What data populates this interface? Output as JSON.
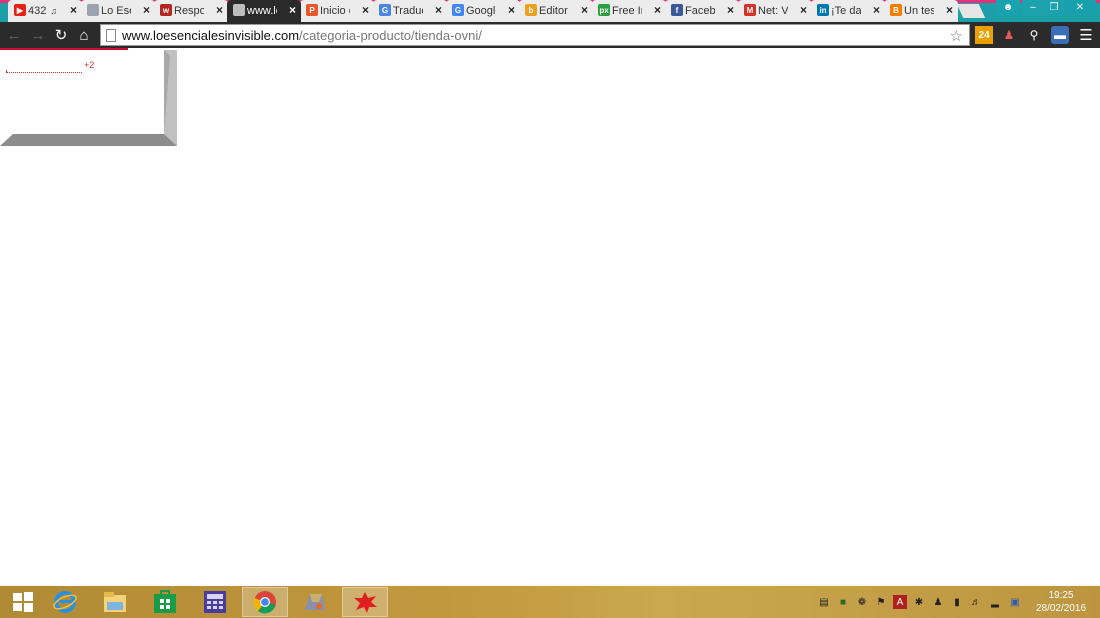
{
  "browser": {
    "tabs": [
      {
        "title": "432",
        "favicon": "youtube-icon",
        "color": "#e62117",
        "muted": true,
        "active": false
      },
      {
        "title": "Lo Esen",
        "favicon": "generic-page-icon",
        "color": "#9aa4b0",
        "active": false
      },
      {
        "title": "Respon",
        "favicon": "w-icon",
        "color": "#b5261e",
        "active": false
      },
      {
        "title": "www.lo",
        "favicon": "generic-page-icon",
        "color": "#bdbdbd",
        "active": true
      },
      {
        "title": "Inicio c",
        "favicon": "p-icon",
        "color": "#e8572a",
        "active": false
      },
      {
        "title": "Traduc",
        "favicon": "translate-icon",
        "color": "#4a85e8",
        "active": false
      },
      {
        "title": "Google",
        "favicon": "google-icon",
        "color": "#4285f4",
        "active": false
      },
      {
        "title": "Editor",
        "favicon": "editor-icon",
        "color": "#f0a020",
        "active": false
      },
      {
        "title": "Free In",
        "favicon": "px-icon",
        "color": "#2aa03c",
        "active": false
      },
      {
        "title": "Facebo",
        "favicon": "facebook-icon",
        "color": "#3b5998",
        "active": false
      },
      {
        "title": "Net: Vi",
        "favicon": "gmail-icon",
        "color": "#d93025",
        "active": false
      },
      {
        "title": "¡Te dar",
        "favicon": "linkedin-icon",
        "color": "#0077b5",
        "active": false
      },
      {
        "title": "Un test",
        "favicon": "blogger-icon",
        "color": "#f57d00",
        "active": false
      }
    ],
    "url_host": "www.loesencialesinvisible.com",
    "url_path": "/categoria-producto/tienda-ovni/"
  },
  "page": {
    "counter_text": "+2"
  },
  "taskbar": {
    "pinned": [
      "windows-start-icon",
      "internet-explorer-icon",
      "file-explorer-icon",
      "store-icon",
      "calculator-icon",
      "chrome-icon",
      "app-icon",
      "red-app-icon"
    ],
    "time": "19:25",
    "date": "28/02/2016"
  }
}
